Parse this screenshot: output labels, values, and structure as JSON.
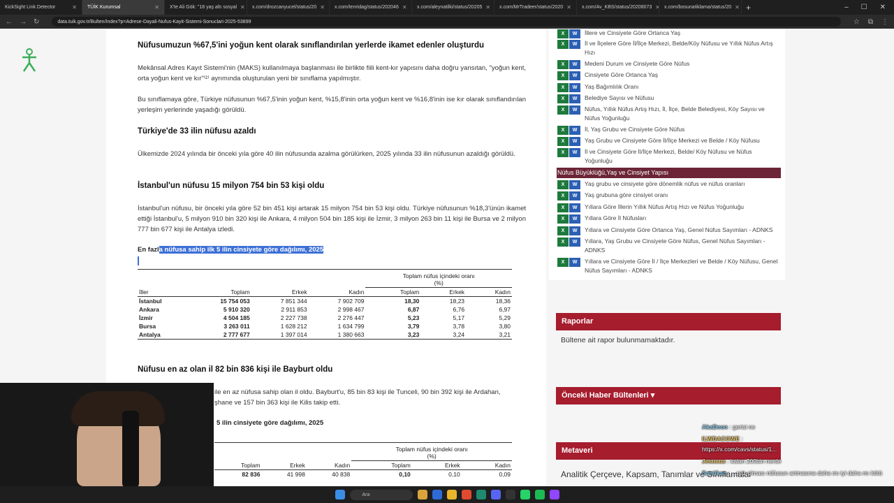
{
  "browser": {
    "tabs": [
      {
        "title": "KickSight Link Detector",
        "active": false
      },
      {
        "title": "TÜİK Kurumsal",
        "active": true
      },
      {
        "title": "X'te Ali Gök: \"18 yaş altı sosyal",
        "active": false
      },
      {
        "title": "x.com/drozcanyucel/status/20",
        "active": false
      },
      {
        "title": "x.com/tenridag/status/202046",
        "active": false
      },
      {
        "title": "x.com/aleynatilki/status/20205",
        "active": false
      },
      {
        "title": "x.com/MrTradeer/status/2020",
        "active": false
      },
      {
        "title": "x.com/Av_KBS/status/20208073",
        "active": false
      },
      {
        "title": "x.com/bosunatiklama/status/20",
        "active": false
      }
    ],
    "url": "data.tuik.gov.tr/Bulten/Index?p=Adrese-Dayali-Nufus-Kayit-Sistemi-Sonuclari-2025-53899"
  },
  "article": {
    "h1": "Nüfusumuzun %67,5'ini yoğun kent olarak sınıflandırılan yerlerde ikamet edenler oluşturdu",
    "p1": "Mekânsal Adres Kayıt Sistemi'nin (MAKS) kullanılmaya başlanması ile birlikte fiili kent-kır yapısını daha doğru yansıtan, \"yoğun kent, orta yoğun kent ve kır\"⁽²⁾ ayrımında oluşturulan yeni bir sınıflama yapılmıştır.",
    "p2": "Bu sınıflamaya göre, Türkiye nüfusunun %67,5'inin yoğun kent, %15,8'inin orta yoğun kent ve %16,8'inin ise kır olarak sınıflandırılan yerleşim yerlerinde yaşadığı görüldü.",
    "h2": "Türkiye'de 33 ilin nüfusu azaldı",
    "p3": "Ülkemizde 2024 yılında bir önceki yıla göre 40 ilin nüfusunda azalma görülürken, 2025 yılında 33 ilin nüfusunun azaldığı görüldü.",
    "h3": "İstanbul'un nüfusu 15 milyon 754 bin 53 kişi oldu",
    "p4": "İstanbul'un nüfusu, bir önceki yıla göre 52 bin 451 kişi artarak 15 milyon 754 bin 53 kişi oldu. Türkiye nüfusunun %18,3'ünün ikamet ettiği İstanbul'u, 5 milyon 910 bin 320 kişi ile Ankara, 4 milyon 504 bin 185 kişi ile İzmir, 3 milyon 263 bin 11 kişi ile Bursa ve 2 milyon 777 bin 677 kişi ile Antalya izledi.",
    "table1_title_pre": "En fazl",
    "table1_title_sel": "a nüfusa sahip ilk 5 ilin cinsiyete göre dağılımı, 2025",
    "h4": "Nüfusu en az olan il 82 bin 836 kişi ile Bayburt oldu",
    "p5a": "ile en az nüfusa sahip olan il oldu. Bayburt'u, 85 bin 83 kişi ile Tunceli, 90 bin 392 kişi ile Ardahan,",
    "p5b": "şhane ve 157 bin 363 kişi ile Kilis takip etti.",
    "table2_title": "5 ilin cinsiyete göre dağılımı, 2025"
  },
  "table1": {
    "group_header": "Toplam nüfus içindeki oranı",
    "group_unit": "(%)",
    "headers": [
      "İller",
      "Toplam",
      "Erkek",
      "Kadın",
      "Toplam",
      "Erkek",
      "Kadın"
    ],
    "rows": [
      [
        "İstanbul",
        "15 754 053",
        "7 851 344",
        "7 902 709",
        "18,30",
        "18,23",
        "18,36"
      ],
      [
        "Ankara",
        "5 910 320",
        "2 911 853",
        "2 998 467",
        "6,87",
        "6,76",
        "6,97"
      ],
      [
        "İzmir",
        "4 504 185",
        "2 227 738",
        "2 276 447",
        "5,23",
        "5,17",
        "5,29"
      ],
      [
        "Bursa",
        "3 263 011",
        "1 628 212",
        "1 634 799",
        "3,79",
        "3,78",
        "3,80"
      ],
      [
        "Antalya",
        "2 777 677",
        "1 397 014",
        "1 380 663",
        "3,23",
        "3,24",
        "3,21"
      ]
    ]
  },
  "table2": {
    "group_header": "Toplam nüfus içindeki oranı",
    "group_unit": "(%)",
    "headers": [
      "Toplam",
      "Erkek",
      "Kadın",
      "Toplam",
      "Erkek",
      "Kadın"
    ],
    "row": [
      "82 836",
      "41 998",
      "40 838",
      "0,10",
      "0,10",
      "0,09"
    ]
  },
  "sidebar": {
    "items_a": [
      "İllere ve Cinsiyete Göre Ortanca Yaş",
      "İl ve İlçelere Göre İl/İlçe Merkezi, Belde/Köy Nüfusu ve Yıllık Nüfus Artış Hızı",
      "Medeni Durum ve Cinsiyete Göre Nüfus",
      "Cinsiyete Göre Ortanca Yaş",
      "Yaş Bağımlılık Oranı",
      "Belediye Sayısı ve Nüfusu",
      "Nüfus, Yıllık Nüfus Artış Hızı, İl, İlçe, Belde Belediyesi, Köy Sayısı ve Nüfus Yoğunluğu",
      "İl, Yaş Grubu ve Cinsiyete Göre Nüfus",
      "Yaş Grubu ve Cinsiyete Göre İl/İlçe Merkezi ve Belde / Köy Nüfusu",
      "İl ve Cinsiyete Göre İl/İlçe Merkezi, Belde/ Köy Nüfusu ve Nüfus Yoğunluğu"
    ],
    "section": "Nüfus Büyüklüğü,Yaş ve Cinsiyet Yapısı",
    "items_b": [
      "Yaş grubu ve cinsiyete göre dönemlik nüfus ve nüfus oranları",
      "Yaş grubuna göre cinsiyet oranı",
      "Yıllara Göre İllerin Yıllık Nüfus Artış Hızı ve Nüfus Yoğunluğu",
      "Yıllara Göre İl Nüfusları",
      "Yıllara ve Cinsiyete Göre Ortanca Yaş, Genel Nüfus Sayımları - ADNKS",
      "Yıllara, Yaş Grubu ve Cinsiyete Göre Nüfus, Genel Nüfus Sayımları - ADNKS",
      "Yıllara ve Cinsiyete Göre İl / İlçe Merkezleri ve Belde / Köy Nüfusu, Genel Nüfus Sayımları - ADNKS"
    ],
    "excel_label": "X",
    "word_label": "W"
  },
  "boxes": {
    "raporlar_title": "Raporlar",
    "raporlar_body": "Bültene ait rapor bulunmamaktadır.",
    "onceki_title": "Önceki Haber Bültenleri ▾",
    "metaveri_title": "Metaveri",
    "metaveri_body": "Analitik Çerçeve, Kapsam, Tanımlar ve Sınıflamalar"
  },
  "chat": [
    {
      "user": "AkaDeon",
      "msg": "gerisi ne"
    },
    {
      "user": "ILWDACOWE",
      "msg": ""
    },
    {
      "user": "",
      "msg": "https://x.com/cavs/status/1..."
    },
    {
      "user": "Jesusus",
      "msg": "kalan 200bin nerde"
    },
    {
      "user": "Santikan",
      "msg": "...rsiz olması nüfusun artmasına daha mı iyi daha mı kötü"
    },
    {
      "user": "remembernorussian",
      "msg": "inşallah sorunsuz ulaşır"
    }
  ],
  "taskbar": {
    "search_placeholder": "Ara"
  },
  "colors": {
    "accent": "#a61d2e",
    "section": "#6b2536",
    "selection": "#3b6fd6"
  }
}
